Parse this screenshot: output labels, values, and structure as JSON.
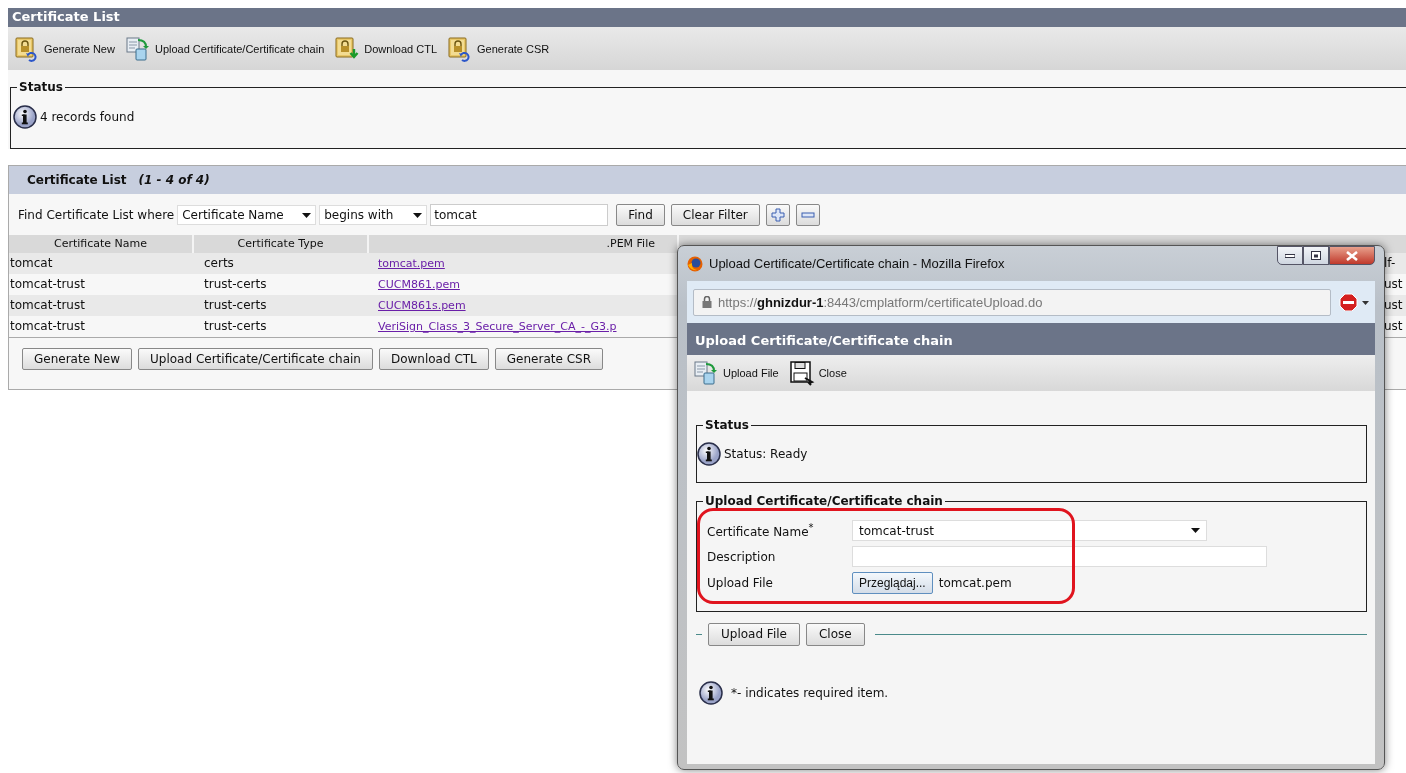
{
  "page": {
    "title": "Certificate List",
    "toolbar": [
      {
        "label": "Generate New",
        "kind": "generate"
      },
      {
        "label": "Upload Certificate/Certificate chain",
        "kind": "upload"
      },
      {
        "label": "Download CTL",
        "kind": "download"
      },
      {
        "label": "Generate CSR",
        "kind": "generate"
      }
    ],
    "status": {
      "legend": "Status",
      "message": "4 records found"
    },
    "certificate_list": {
      "title": "Certificate List",
      "range": "(1 - 4 of 4)",
      "find_label": "Find Certificate List where",
      "field_select": "Certificate Name",
      "operator_select": "begins with",
      "search_value": "tomcat",
      "find_button": "Find",
      "clear_button": "Clear Filter",
      "columns": [
        "Certificate Name",
        "Certificate Type",
        ".PEM File"
      ],
      "rows": [
        {
          "name": "tomcat",
          "type": "certs",
          "pem_file": "tomcat.pem",
          "column_4": "lf-"
        },
        {
          "name": "tomcat-trust",
          "type": "trust-certs",
          "pem_file": "CUCM861.pem",
          "column_4": "ust"
        },
        {
          "name": "tomcat-trust",
          "type": "trust-certs",
          "pem_file": "CUCM861s.pem",
          "column_4": "ust"
        },
        {
          "name": "tomcat-trust",
          "type": "trust-certs",
          "pem_file": "VeriSign_Class_3_Secure_Server_CA_-_G3.p",
          "column_4": "ust"
        }
      ],
      "buttons": [
        "Generate New",
        "Upload Certificate/Certificate chain",
        "Download CTL",
        "Generate CSR"
      ]
    }
  },
  "dialog": {
    "window_title": "Upload Certificate/Certificate chain - Mozilla Firefox",
    "url": {
      "scheme": "https://",
      "host": "ghnizdur-1",
      "path": ":8443/cmplatform/certificateUpload.do"
    },
    "header": "Upload Certificate/Certificate chain",
    "toolbar": [
      {
        "label": "Upload File",
        "kind": "upload"
      },
      {
        "label": "Close",
        "kind": "close"
      }
    ],
    "status": {
      "legend": "Status",
      "message": "Status: Ready"
    },
    "form": {
      "legend": "Upload Certificate/Certificate chain",
      "highlighted": true,
      "fields": [
        {
          "kind": "select",
          "label": "Certificate Name",
          "required_mark": "*",
          "value": "tomcat-trust"
        },
        {
          "kind": "text",
          "label": "Description"
        },
        {
          "kind": "file",
          "label": "Upload File",
          "button": "Przeglądaj...",
          "value": "tomcat.pem"
        }
      ]
    },
    "buttons": [
      "Upload File",
      "Close"
    ],
    "note": "*- indicates required item."
  }
}
